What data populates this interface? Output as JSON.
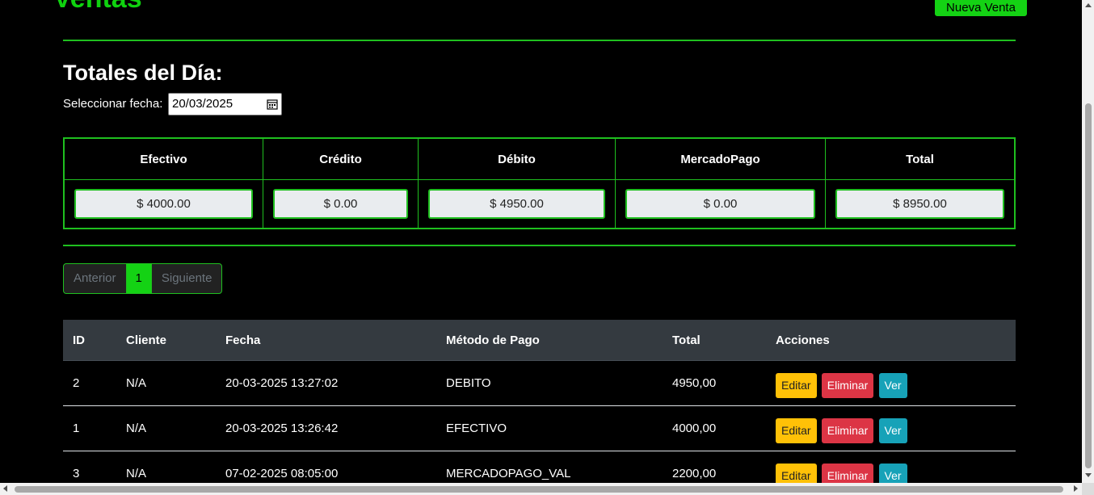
{
  "header": {
    "title": "Ventas",
    "new_sale_label": "Nueva Venta"
  },
  "totals": {
    "heading": "Totales del Día:",
    "date_label": "Seleccionar fecha:",
    "date_value": "20/03/2025",
    "columns": [
      "Efectivo",
      "Crédito",
      "Débito",
      "MercadoPago",
      "Total"
    ],
    "values": [
      "$ 4000.00",
      "$ 0.00",
      "$ 4950.00",
      "$ 0.00",
      "$ 8950.00"
    ]
  },
  "pagination": {
    "prev_label": "Anterior",
    "current_page": "1",
    "next_label": "Siguiente"
  },
  "sales_table": {
    "headers": [
      "ID",
      "Cliente",
      "Fecha",
      "Método de Pago",
      "Total",
      "Acciones"
    ],
    "rows": [
      {
        "id": "2",
        "cliente": "N/A",
        "fecha": "20-03-2025 13:27:02",
        "metodo": "DEBITO",
        "total": "4950,00"
      },
      {
        "id": "1",
        "cliente": "N/A",
        "fecha": "20-03-2025 13:26:42",
        "metodo": "EFECTIVO",
        "total": "4000,00"
      },
      {
        "id": "3",
        "cliente": "N/A",
        "fecha": "07-02-2025 08:05:00",
        "metodo": "MERCADOPAGO_VAL",
        "total": "2200,00"
      }
    ],
    "actions": {
      "edit_label": "Editar",
      "delete_label": "Eliminar",
      "view_label": "Ver"
    }
  },
  "colors": {
    "accent_green": "#14d214",
    "edit": "#ffc107",
    "delete": "#dc3545",
    "view": "#17a2b8"
  }
}
